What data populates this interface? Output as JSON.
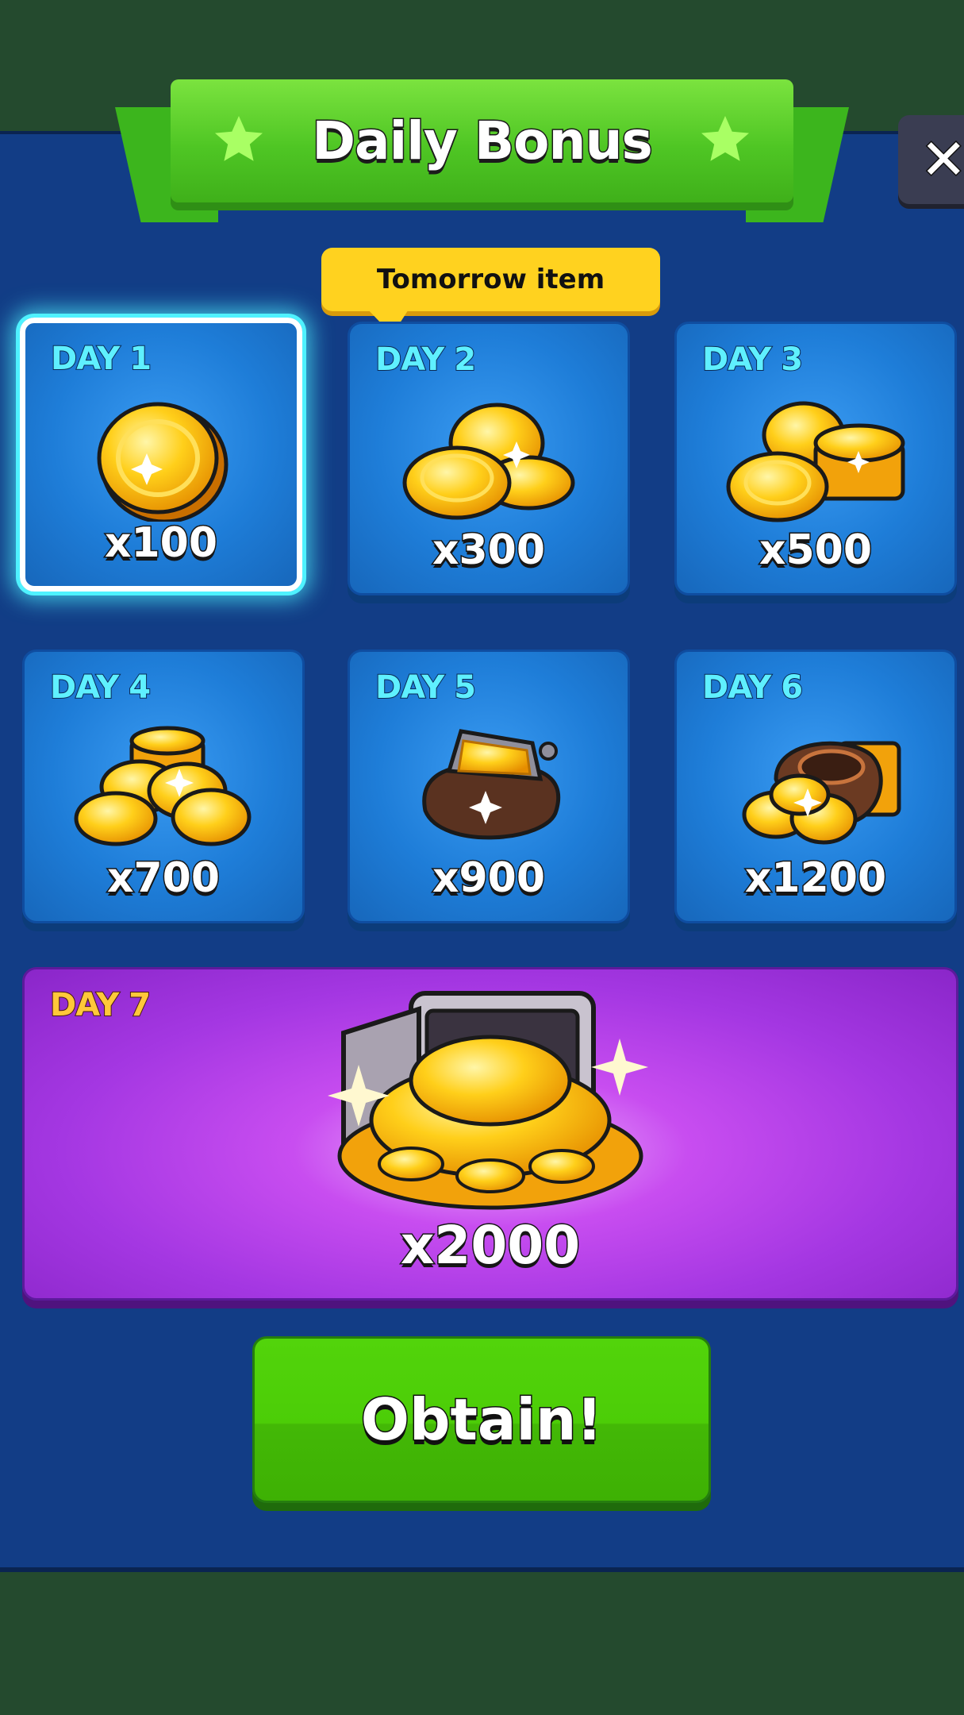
{
  "header": {
    "title": "Daily Bonus"
  },
  "close": {
    "label": "✕"
  },
  "tooltip": {
    "text": "Tomorrow item"
  },
  "days": [
    {
      "label": "DAY 1",
      "amount": "x100",
      "icon": "single-coin-icon",
      "active": true
    },
    {
      "label": "DAY 2",
      "amount": "x300",
      "icon": "coin-pair-icon"
    },
    {
      "label": "DAY 3",
      "amount": "x500",
      "icon": "coin-stack-icon"
    },
    {
      "label": "DAY 4",
      "amount": "x700",
      "icon": "coin-pile-icon"
    },
    {
      "label": "DAY 5",
      "amount": "x900",
      "icon": "coin-purse-icon"
    },
    {
      "label": "DAY 6",
      "amount": "x1200",
      "icon": "coin-sack-icon"
    },
    {
      "label": "DAY 7",
      "amount": "x2000",
      "icon": "coin-vault-icon"
    }
  ],
  "obtain": {
    "label": "Obtain!"
  },
  "colors": {
    "panel": "#123d86",
    "banner": "#4fc624",
    "day_label": "#5ff0ff",
    "day7_label": "#ffc83a",
    "button": "#4ccd07"
  }
}
